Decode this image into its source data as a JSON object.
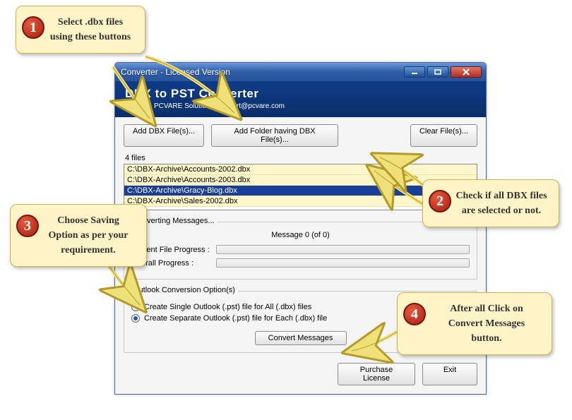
{
  "window": {
    "title": "Converter - Licensed Version"
  },
  "banner": {
    "product": "DBX to PST Converter",
    "copyright": "(C) 2011 PCVARE Solutions, support@pcvare.com"
  },
  "toolbar": {
    "add_file": "Add DBX File(s)...",
    "add_folder": "Add Folder having DBX File(s)...",
    "clear": "Clear File(s)..."
  },
  "files": {
    "count_label": "4 files",
    "items": [
      "C:\\DBX-Archive\\Accounts-2002.dbx",
      "C:\\DBX-Archive\\Accounts-2003.dbx",
      "C:\\DBX-Archive\\Gracy-Blog.dbx",
      "C:\\DBX-Archive\\Sales-2002.dbx"
    ],
    "selected_index": 2
  },
  "progress_group": {
    "legend": "Converting Messages...",
    "message": "Message 0 (of 0)",
    "current_label": "Current File Progress :",
    "overall_label": "Overall Progress         :"
  },
  "options_group": {
    "legend": "Outlook Conversion Option(s)",
    "opt_single": "Create Single Outlook (.pst) file for All (.dbx) files",
    "opt_separate": "Create Separate Outlook (.pst) file for Each (.dbx) file",
    "selected": "separate"
  },
  "actions": {
    "convert": "Convert Messages",
    "purchase": "Purchase License",
    "exit": "Exit"
  },
  "callouts": {
    "c1": {
      "num": "1",
      "text": "Select .dbx files using these buttons"
    },
    "c2": {
      "num": "2",
      "text": "Check if all DBX files are selected or not."
    },
    "c3": {
      "num": "3",
      "text": "Choose Saving Option as per your requirement."
    },
    "c4": {
      "num": "4",
      "text": "After all Click on Convert Messages button."
    }
  }
}
